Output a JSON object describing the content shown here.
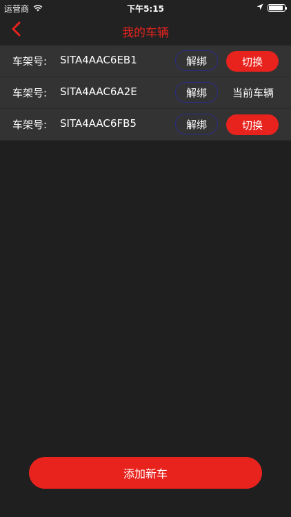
{
  "status_bar": {
    "carrier": "运营商",
    "time": "下午5:15"
  },
  "header": {
    "title": "我的车辆",
    "back_icon": "chevron-left-icon"
  },
  "vehicles": [
    {
      "vin_label": "车架号:",
      "vin": "SITA4AAC6EB1",
      "unbind_label": "解绑",
      "action_label": "切换",
      "is_current": false
    },
    {
      "vin_label": "车架号:",
      "vin": "SITA4AAC6A2E",
      "unbind_label": "解绑",
      "action_label": "当前车辆",
      "is_current": true
    },
    {
      "vin_label": "车架号:",
      "vin": "SITA4AAC6FB5",
      "unbind_label": "解绑",
      "action_label": "切换",
      "is_current": false
    }
  ],
  "footer": {
    "add_label": "添加新车"
  },
  "colors": {
    "accent": "#e8231e",
    "background": "#1f1f1f",
    "row_background": "#333333",
    "unbind_border": "#2b2b8a"
  }
}
